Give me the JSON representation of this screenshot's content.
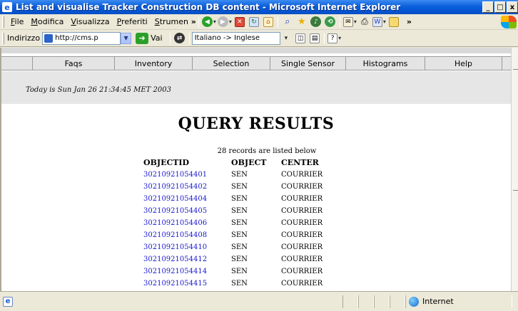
{
  "window": {
    "title": "List and visualise Tracker Construction DB content - Microsoft Internet Explorer",
    "controls": [
      "_",
      "□",
      "x"
    ]
  },
  "menubar": {
    "items": [
      {
        "label": "File",
        "access": "F"
      },
      {
        "label": "Modifica",
        "access": "M"
      },
      {
        "label": "Visualizza",
        "access": "V"
      },
      {
        "label": "Preferiti",
        "access": "P"
      },
      {
        "label": "Strumenti",
        "access": "S"
      }
    ],
    "overflow": "»"
  },
  "addressbar": {
    "label": "Indirizzo",
    "url": "http://cms.p",
    "go_label": "Vai",
    "translate_value": "Italiano -> Inglese"
  },
  "nav": {
    "items": [
      "Faqs",
      "Inventory",
      "Selection",
      "Single Sensor",
      "Histograms",
      "Help"
    ]
  },
  "page": {
    "date_line": "Today is Sun Jan 26 21:34:45 MET 2003",
    "title": "QUERY RESULTS",
    "records_line": "28 records are listed below",
    "columns": [
      "OBJECTID",
      "OBJECT",
      "CENTER"
    ],
    "rows": [
      {
        "objectid": "30210921054401",
        "object": "SEN",
        "center": "COURRIER"
      },
      {
        "objectid": "30210921054402",
        "object": "SEN",
        "center": "COURRIER"
      },
      {
        "objectid": "30210921054404",
        "object": "SEN",
        "center": "COURRIER"
      },
      {
        "objectid": "30210921054405",
        "object": "SEN",
        "center": "COURRIER"
      },
      {
        "objectid": "30210921054406",
        "object": "SEN",
        "center": "COURRIER"
      },
      {
        "objectid": "30210921054408",
        "object": "SEN",
        "center": "COURRIER"
      },
      {
        "objectid": "30210921054410",
        "object": "SEN",
        "center": "COURRIER"
      },
      {
        "objectid": "30210921054412",
        "object": "SEN",
        "center": "COURRIER"
      },
      {
        "objectid": "30210921054414",
        "object": "SEN",
        "center": "COURRIER"
      },
      {
        "objectid": "30210921054415",
        "object": "SEN",
        "center": "COURRIER"
      }
    ]
  },
  "statusbar": {
    "zone": "Internet"
  },
  "colors": {
    "titlebar": "#0a5fdb",
    "link": "#1a1ad0",
    "chrome": "#ece9d8"
  }
}
